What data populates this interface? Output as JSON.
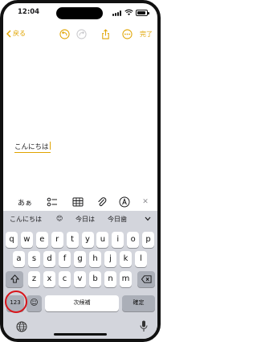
{
  "status_bar": {
    "time": "12:04"
  },
  "nav": {
    "back_label": "戻る",
    "done_label": "完了"
  },
  "note": {
    "text": "こんにちは"
  },
  "toolbar": {
    "aa_label": "あぁ",
    "close_glyph": "✕"
  },
  "candidates": [
    "こんにちは",
    "😊",
    "今日は",
    "今日歯"
  ],
  "keyboard": {
    "row1": [
      "q",
      "w",
      "e",
      "r",
      "t",
      "y",
      "u",
      "i",
      "o",
      "p"
    ],
    "row2": [
      "a",
      "s",
      "d",
      "f",
      "g",
      "h",
      "j",
      "k",
      "l"
    ],
    "row3": [
      "z",
      "x",
      "c",
      "v",
      "b",
      "n",
      "m"
    ],
    "numbers_label": "123",
    "space_label": "次候補",
    "return_label": "確定",
    "emoji_glyph": "☺"
  },
  "colors": {
    "accent": "#e0a400",
    "highlight_circle": "#d8141a"
  }
}
